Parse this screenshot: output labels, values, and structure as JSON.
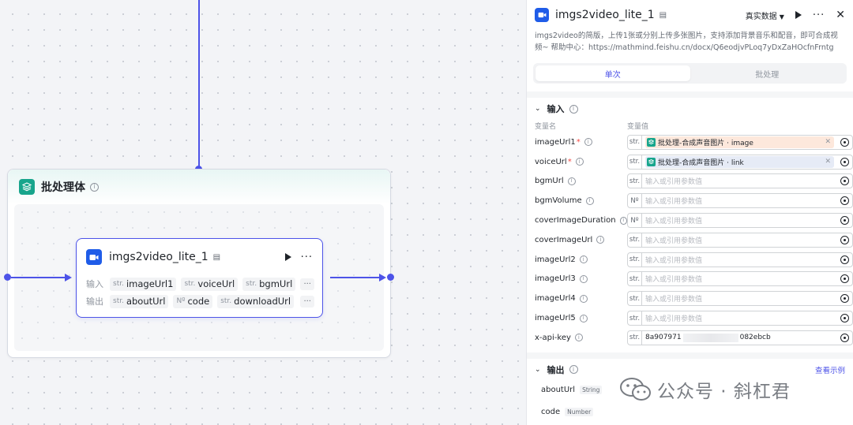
{
  "canvas": {
    "batch_node": {
      "title": "批处理体"
    },
    "inner_node": {
      "title": "imgs2video_lite_1",
      "input_label": "输入",
      "output_label": "输出",
      "inputs": [
        {
          "type": "str.",
          "name": "imageUrl1"
        },
        {
          "type": "str.",
          "name": "voiceUrl"
        },
        {
          "type": "str.",
          "name": "bgmUrl"
        }
      ],
      "outputs": [
        {
          "type": "str.",
          "name": "aboutUrl"
        },
        {
          "type": "Nº",
          "name": "code"
        },
        {
          "type": "str.",
          "name": "downloadUrl"
        }
      ],
      "more_label": "···"
    }
  },
  "panel": {
    "title": "imgs2video_lite_1",
    "data_dropdown": "真实数据",
    "description": "imgs2video的简版，上传1张或分别上传多张图片，支持添加背景音乐和配音，即可合成视频~ 帮助中心：https://mathmind.feishu.cn/docx/Q6eodjvPLoq7yDxZaHOcfnFrntg",
    "tabs": [
      {
        "label": "单次",
        "active": true
      },
      {
        "label": "批处理",
        "active": false
      }
    ],
    "input_section": {
      "title": "输入",
      "col_name": "变量名",
      "col_value": "变量值",
      "params": [
        {
          "name": "imageUrl1",
          "required": true,
          "type": "str.",
          "ref": "批处理-合成声音图片 · image",
          "ref_color": "orange"
        },
        {
          "name": "voiceUrl",
          "required": true,
          "type": "str.",
          "ref": "批处理-合成声音图片 · link",
          "ref_color": "blue"
        },
        {
          "name": "bgmUrl",
          "required": false,
          "type": "str.",
          "placeholder": "输入或引用参数值"
        },
        {
          "name": "bgmVolume",
          "required": false,
          "type": "Nº",
          "placeholder": "输入或引用参数值"
        },
        {
          "name": "coverImageDuration",
          "required": false,
          "type": "Nº",
          "placeholder": "输入或引用参数值"
        },
        {
          "name": "coverImageUrl",
          "required": false,
          "type": "str.",
          "placeholder": "输入或引用参数值"
        },
        {
          "name": "imageUrl2",
          "required": false,
          "type": "str.",
          "placeholder": "输入或引用参数值"
        },
        {
          "name": "imageUrl3",
          "required": false,
          "type": "str.",
          "placeholder": "输入或引用参数值"
        },
        {
          "name": "imageUrl4",
          "required": false,
          "type": "str.",
          "placeholder": "输入或引用参数值"
        },
        {
          "name": "imageUrl5",
          "required": false,
          "type": "str.",
          "placeholder": "输入或引用参数值"
        },
        {
          "name": "x-api-key",
          "required": false,
          "type": "str.",
          "value_prefix": "8a907971",
          "value_suffix": "082ebcb"
        }
      ]
    },
    "output_section": {
      "title": "输出",
      "link": "查看示例",
      "outputs": [
        {
          "name": "aboutUrl",
          "type": "String"
        },
        {
          "name": "code",
          "type": "Number"
        }
      ]
    }
  },
  "watermark": {
    "text": "公众号 · 斜杠君"
  },
  "colors": {
    "accent": "#4d53e8",
    "batch_teal": "#18a58c",
    "camera_blue": "#1f5ce8"
  }
}
